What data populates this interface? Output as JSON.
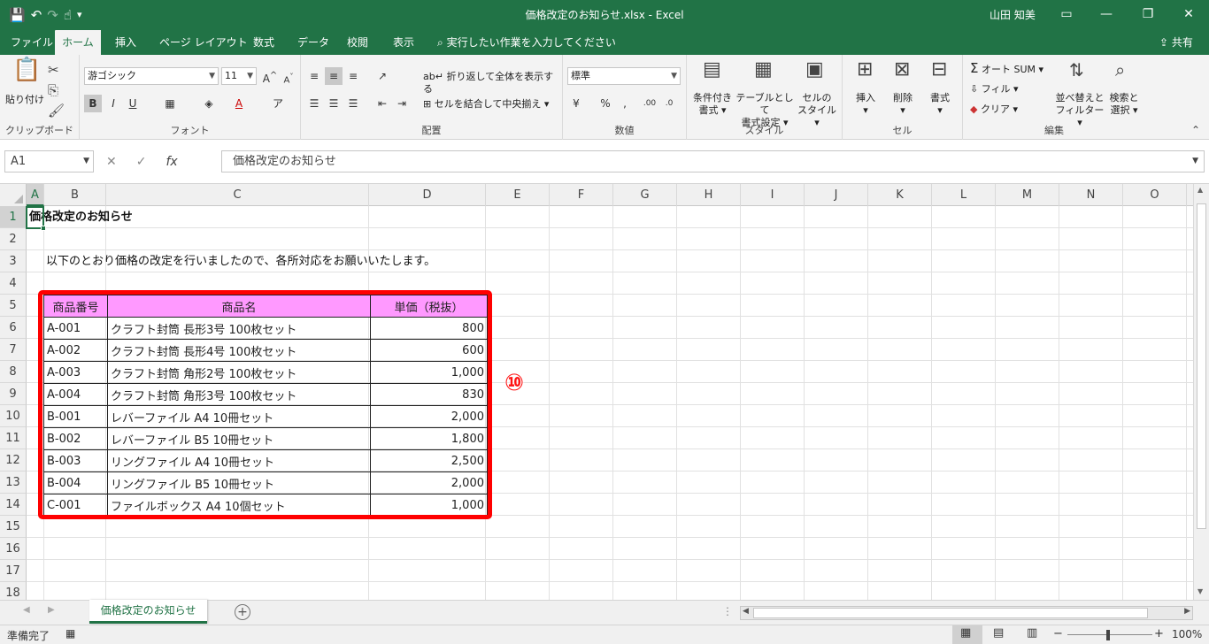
{
  "window": {
    "title": "価格改定のお知らせ.xlsx  -  Excel",
    "user": "山田 知美"
  },
  "tabs": [
    {
      "label": "ファイル"
    },
    {
      "label": "ホーム"
    },
    {
      "label": "挿入"
    },
    {
      "label": "ページ レイアウト"
    },
    {
      "label": "数式"
    },
    {
      "label": "データ"
    },
    {
      "label": "校閲"
    },
    {
      "label": "表示"
    }
  ],
  "tell_me": "実行したい作業を入力してください",
  "share": "共有",
  "ribbon": {
    "clipboard": {
      "paste": "貼り付け",
      "label": "クリップボード"
    },
    "font": {
      "name": "游ゴシック",
      "size": "11",
      "label": "フォント"
    },
    "alignment": {
      "wrap": "折り返して全体を表示する",
      "merge": "セルを結合して中央揃え",
      "label": "配置"
    },
    "number": {
      "format": "標準",
      "label": "数値"
    },
    "styles": {
      "conditional": "条件付き",
      "conditional2": "書式",
      "table": "テーブルとして",
      "table2": "書式設定",
      "cell": "セルの",
      "cell2": "スタイル",
      "label": "スタイル"
    },
    "cells": {
      "insert": "挿入",
      "delete": "削除",
      "format": "書式",
      "label": "セル"
    },
    "editing": {
      "autosum": "オート SUM",
      "fill": "フィル",
      "clear": "クリア",
      "sort": "並べ替えと",
      "sort2": "フィルター",
      "find": "検索と",
      "find2": "選択",
      "label": "編集"
    }
  },
  "namebox": "A1",
  "formula": "価格改定のお知らせ",
  "columns": [
    "A",
    "B",
    "C",
    "D",
    "E",
    "F",
    "G",
    "H",
    "I",
    "J",
    "K",
    "L",
    "M",
    "N",
    "O"
  ],
  "rows": [
    "1",
    "2",
    "3",
    "4",
    "5",
    "6",
    "7",
    "8",
    "9",
    "10",
    "11",
    "12",
    "13",
    "14",
    "15",
    "16",
    "17",
    "18"
  ],
  "sheet": {
    "title": "価格改定のお知らせ",
    "intro": "以下のとおり価格の改定を行いましたので、各所対応をお願いいたします。",
    "headers": [
      "商品番号",
      "商品名",
      "単価（税抜）"
    ],
    "items": [
      {
        "code": "A-001",
        "name": "クラフト封筒 長形3号 100枚セット",
        "price": "800"
      },
      {
        "code": "A-002",
        "name": "クラフト封筒 長形4号 100枚セット",
        "price": "600"
      },
      {
        "code": "A-003",
        "name": "クラフト封筒 角形2号 100枚セット",
        "price": "1,000"
      },
      {
        "code": "A-004",
        "name": "クラフト封筒 角形3号 100枚セット",
        "price": "830"
      },
      {
        "code": "B-001",
        "name": "レバーファイル A4 10冊セット",
        "price": "2,000"
      },
      {
        "code": "B-002",
        "name": "レバーファイル B5 10冊セット",
        "price": "1,800"
      },
      {
        "code": "B-003",
        "name": "リングファイル A4 10冊セット",
        "price": "2,500"
      },
      {
        "code": "B-004",
        "name": "リングファイル B5 10冊セット",
        "price": "2,000"
      },
      {
        "code": "C-001",
        "name": "ファイルボックス A4 10個セット",
        "price": "1,000"
      }
    ]
  },
  "marker": "⑩",
  "sheet_tab": "価格改定のお知らせ",
  "status": {
    "ready": "準備完了",
    "zoom": "100%"
  }
}
